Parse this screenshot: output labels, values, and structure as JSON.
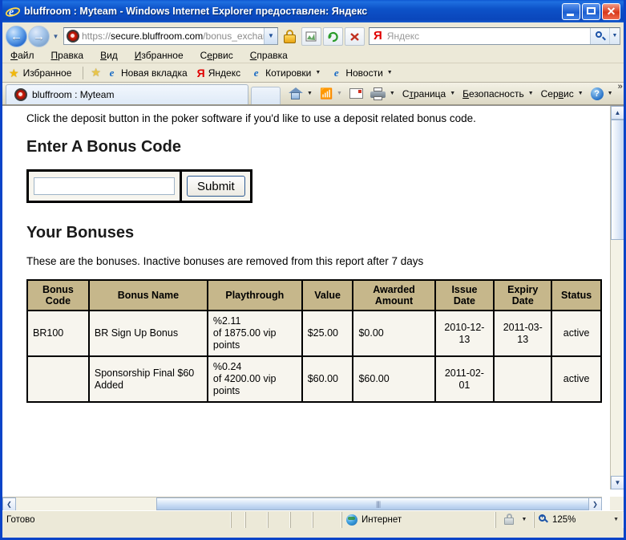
{
  "window": {
    "title": "bluffroom : Myteam - Windows Internet Explorer предоставлен: Яндекс",
    "minimize_label": "Свернуть",
    "maximize_label": "Развернуть",
    "close_label": "Закрыть"
  },
  "navbar": {
    "back_glyph": "←",
    "forward_glyph": "→",
    "history_caret": "▼",
    "url_scheme": "https",
    "url_sep": "://",
    "url_host": "secure.bluffroom.com",
    "url_path": "/bonus_exchange",
    "address_caret": "▼",
    "lock_title": "Безопасное соединение",
    "compat_title": "Режим совместимости",
    "refresh_glyph": "↻",
    "stop_glyph": "✕",
    "search_brand": "Я",
    "search_placeholder": "Яндекс",
    "search_value": "",
    "search_caret": "▼"
  },
  "menubar": {
    "items": [
      {
        "pre": "",
        "accel": "Ф",
        "post": "айл"
      },
      {
        "pre": "",
        "accel": "П",
        "post": "равка"
      },
      {
        "pre": "",
        "accel": "В",
        "post": "ид"
      },
      {
        "pre": "",
        "accel": "И",
        "post": "збранное"
      },
      {
        "pre": "С",
        "accel": "е",
        "post": "рвис"
      },
      {
        "pre": "",
        "accel": "С",
        "post": "правка"
      }
    ]
  },
  "favbar": {
    "favorites_label": "Избранное",
    "items": [
      {
        "label": "Новая вкладка",
        "icon": "ie-page-icon",
        "caret": false
      },
      {
        "label": "Яндекс",
        "icon": "yandex-icon",
        "caret": false
      },
      {
        "label": "Котировки",
        "icon": "ie-page-icon",
        "caret": true
      },
      {
        "label": "Новости",
        "icon": "ie-page-icon",
        "caret": true
      }
    ],
    "caret_glyph": "▼"
  },
  "tabs": {
    "active_tab_label": "bluffroom : Myteam",
    "new_tab_label": ""
  },
  "commandbar": {
    "items": [
      {
        "name": "home",
        "label": "",
        "caret": true
      },
      {
        "name": "feeds",
        "label": "",
        "caret": true
      },
      {
        "name": "mail",
        "label": "",
        "caret": false
      },
      {
        "name": "print",
        "label": "",
        "caret": true
      }
    ],
    "menus": [
      {
        "pre": "С",
        "accel": "т",
        "post": "раница",
        "caret": "▼"
      },
      {
        "pre": "",
        "accel": "Б",
        "post": "езопасность",
        "caret": "▼"
      },
      {
        "pre": "Сер",
        "accel": "в",
        "post": "ис",
        "caret": "▼"
      }
    ],
    "help_glyph": "?",
    "help_caret": "▼",
    "overflow_glyph": "»",
    "caret_glyph": "▼"
  },
  "page": {
    "intro": "Click the deposit button in the poker software if you'd like to use a deposit related bonus code.",
    "enter_code_heading": "Enter A Bonus Code",
    "bonus_input_value": "",
    "bonus_input_placeholder": "",
    "submit_label": "Submit",
    "bonuses_heading": "Your Bonuses",
    "bonuses_subtext": "These are the bonuses. Inactive bonuses are removed from this report after 7 days",
    "table": {
      "headers": [
        "Bonus Code",
        "Bonus Name",
        "Playthrough",
        "Value",
        "Awarded Amount",
        "Issue Date",
        "Expiry Date",
        "Status"
      ],
      "rows": [
        {
          "code": "BR100",
          "name": "BR Sign Up Bonus",
          "playthrough_pct": "%2.11",
          "playthrough_of": "of 1875.00 vip",
          "playthrough_unit": "points",
          "value": "$25.00",
          "awarded": "$0.00",
          "issue_date": "2010-12-13",
          "expiry_date": "2011-03-13",
          "status": "active"
        },
        {
          "code": "",
          "name": "Sponsorship Final $60 Added",
          "playthrough_pct": "%0.24",
          "playthrough_of": "of 4200.00 vip",
          "playthrough_unit": "points",
          "value": "$60.00",
          "awarded": "$60.00",
          "issue_date": "2011-02-01",
          "expiry_date": "",
          "status": "active"
        }
      ]
    }
  },
  "scrollbars": {
    "up_glyph": "▲",
    "down_glyph": "▼",
    "left_glyph": "❮",
    "right_glyph": "❯",
    "thumb_grip": "||||"
  },
  "statusbar": {
    "status_text": "Готово",
    "zone_text": "Интернет",
    "zoom_text": "125%",
    "zoom_caret": "▼",
    "privacy_caret": "▼"
  },
  "colors": {
    "titlebar_blue": "#0d52c8",
    "chrome_tan": "#ece9d8",
    "table_header_tan": "#c6b78b",
    "table_body": "#f7f5ee",
    "link_blue": "#0000ee"
  }
}
